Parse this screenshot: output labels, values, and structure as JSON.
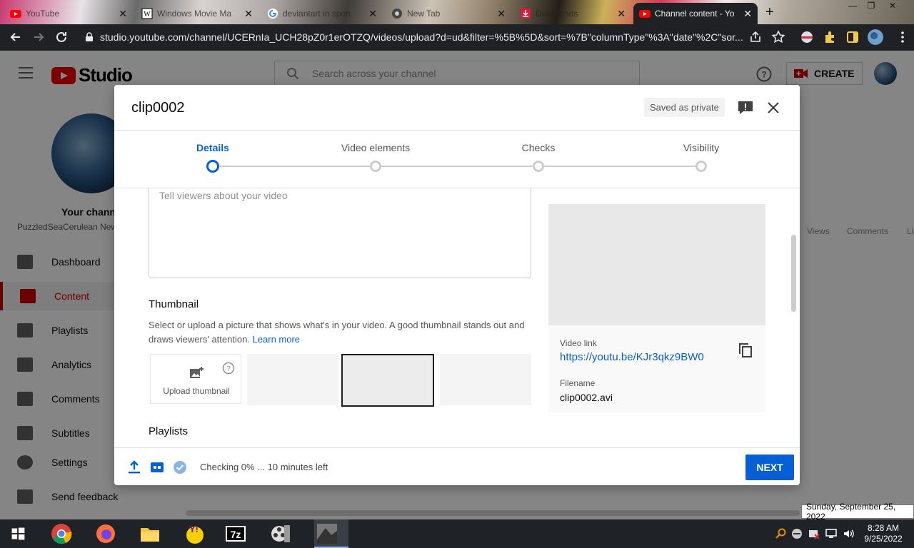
{
  "browser": {
    "tabs": [
      {
        "title": "YouTube",
        "icon": "youtube-icon"
      },
      {
        "title": "Windows Movie Ma",
        "icon": "wikipedia-icon"
      },
      {
        "title": "deviantart in spon",
        "icon": "google-icon"
      },
      {
        "title": "New Tab",
        "icon": "chrome-icon"
      },
      {
        "title": "Downloads",
        "icon": "download-icon"
      },
      {
        "title": "Channel content - Yo",
        "icon": "youtube-icon",
        "active": true
      }
    ],
    "new_tab": "+",
    "url": "studio.youtube.com/channel/UCERnIa_UCH28pZ0r1erOTZQ/videos/upload?d=ud&filter=%5B%5D&sort=%7B\"columnType\"%3A\"date\"%2C\"sor..."
  },
  "studio": {
    "logo_text": "Studio",
    "search_placeholder": "Search across your channel",
    "create_label": "CREATE",
    "your_channel": "Your channel",
    "channel_name": "PuzzledSeaCerulean New",
    "nav": [
      {
        "label": "Dashboard",
        "icon": "dashboard-icon"
      },
      {
        "label": "Content",
        "icon": "content-icon",
        "active": true
      },
      {
        "label": "Playlists",
        "icon": "playlists-icon"
      },
      {
        "label": "Analytics",
        "icon": "analytics-icon"
      },
      {
        "label": "Comments",
        "icon": "comments-icon"
      },
      {
        "label": "Subtitles",
        "icon": "subtitles-icon"
      },
      {
        "label": "Settings",
        "icon": "settings-icon"
      },
      {
        "label": "Send feedback",
        "icon": "feedback-icon"
      }
    ],
    "columns": [
      "Views",
      "Comments",
      "Li"
    ]
  },
  "dialog": {
    "title": "clip0002",
    "saved_status": "Saved as private",
    "steps": [
      {
        "label": "Details",
        "active": true
      },
      {
        "label": "Video elements"
      },
      {
        "label": "Checks"
      },
      {
        "label": "Visibility"
      }
    ],
    "description_placeholder": "Tell viewers about your video",
    "thumbnail": {
      "heading": "Thumbnail",
      "text": "Select or upload a picture that shows what's in your video. A good thumbnail stands out and draws viewers' attention.",
      "learn_more": "Learn more",
      "upload_label": "Upload thumbnail"
    },
    "playlists_heading": "Playlists",
    "video_link_label": "Video link",
    "video_link": "https://youtu.be/KJr3qkz9BW0",
    "filename_label": "Filename",
    "filename": "clip0002.avi",
    "status": "Checking 0% ... 10 minutes left",
    "next_label": "NEXT"
  },
  "tooltip": "Sunday, September 25, 2022",
  "taskbar": {
    "time": "8:28 AM",
    "date": "9/25/2022",
    "apps": [
      "start-icon",
      "chrome-icon",
      "firefox-icon",
      "file-explorer-icon",
      "yahoo-messenger-icon",
      "7zip-icon",
      "movie-maker-icon",
      "app-icon"
    ]
  },
  "colors": {
    "accent": "#065fd4",
    "youtube_red": "#ff0000",
    "active_nav": "#cc0000"
  }
}
